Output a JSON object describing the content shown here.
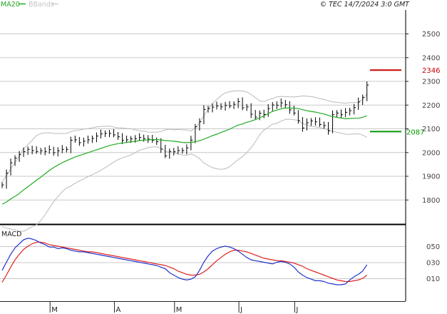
{
  "header": {
    "legend_ma": "MA20",
    "legend_bb": "BBands",
    "copyright": "© TEC 14/7/2024 3:0 GMT"
  },
  "macd_panel": {
    "label": "MACD"
  },
  "colors": {
    "background": "#ffffff",
    "grid": "#c8c8c8",
    "price_bars": "#000000",
    "ma20": "#22aa22",
    "bbands": "#bbbbbb",
    "macd_line": "#2233cc",
    "signal_line": "#dd2222",
    "marker_upper": "#cc0000",
    "marker_lower": "#009900"
  },
  "chart_data": [
    {
      "type": "line",
      "subtype": "ohlc-bars with MA20 and Bollinger Bands",
      "title": "",
      "xlabel": "",
      "ylabel": "",
      "ylim": [
        1700,
        2600
      ],
      "y_ticks": [
        1800,
        1900,
        2000,
        2100,
        2200,
        2300,
        2400,
        2500
      ],
      "y_tick_labels": [
        "1800",
        "1900",
        "2000",
        "2100",
        "2200",
        "2300",
        "2400",
        "2500"
      ],
      "x_month_labels": [
        "M",
        "A",
        "M",
        "J",
        "J"
      ],
      "month_start_index": [
        11,
        26,
        40,
        55,
        68
      ],
      "grid": true,
      "markers": [
        {
          "label": "2346",
          "value": 2346,
          "color": "#cc0000"
        },
        {
          "label": "2087",
          "value": 2087,
          "color": "#009900"
        }
      ],
      "close": [
        1862,
        1912,
        1955,
        1975,
        1990,
        2002,
        2012,
        2007,
        2003,
        2006,
        2003,
        2011,
        1998,
        2006,
        2012,
        2012,
        2050,
        2052,
        2040,
        2046,
        2052,
        2058,
        2068,
        2077,
        2079,
        2079,
        2073,
        2065,
        2050,
        2052,
        2056,
        2057,
        2062,
        2057,
        2055,
        2050,
        2044,
        2013,
        1985,
        2003,
        2002,
        2007,
        2007,
        2018,
        2051,
        2107,
        2128,
        2180,
        2184,
        2190,
        2195,
        2191,
        2197,
        2195,
        2202,
        2213,
        2187,
        2191,
        2160,
        2148,
        2164,
        2159,
        2184,
        2199,
        2198,
        2208,
        2200,
        2178,
        2165,
        2133,
        2102,
        2124,
        2132,
        2128,
        2117,
        2112,
        2090,
        2158,
        2165,
        2158,
        2168,
        2175,
        2188,
        2212,
        2231,
        2283
      ],
      "series": [
        {
          "name": "MA20",
          "values": [
            1781,
            1790,
            1803,
            1814,
            1826,
            1841,
            1854,
            1868,
            1882,
            1895,
            1909,
            1923,
            1935,
            1946,
            1956,
            1964,
            1972,
            1980,
            1986,
            1992,
            1998,
            2004,
            2010,
            2016,
            2022,
            2028,
            2032,
            2036,
            2039,
            2041,
            2044,
            2046,
            2049,
            2051,
            2052,
            2053,
            2053,
            2052,
            2049,
            2048,
            2046,
            2044,
            2041,
            2040,
            2041,
            2044,
            2048,
            2055,
            2062,
            2070,
            2076,
            2083,
            2090,
            2097,
            2106,
            2114,
            2119,
            2126,
            2131,
            2137,
            2145,
            2153,
            2163,
            2172,
            2177,
            2183,
            2186,
            2186,
            2185,
            2184,
            2179,
            2175,
            2172,
            2169,
            2165,
            2161,
            2155,
            2150,
            2147,
            2144,
            2141,
            2142,
            2143,
            2143,
            2147,
            2154
          ]
        },
        {
          "name": "BBands upper",
          "values": [
            1875,
            1900,
            1930,
            1956,
            1985,
            2015,
            2032,
            2050,
            2070,
            2078,
            2082,
            2082,
            2079,
            2079,
            2078,
            2079,
            2087,
            2091,
            2093,
            2097,
            2099,
            2103,
            2106,
            2108,
            2109,
            2110,
            2106,
            2103,
            2102,
            2100,
            2099,
            2094,
            2090,
            2089,
            2085,
            2084,
            2084,
            2087,
            2094,
            2097,
            2094,
            2096,
            2094,
            2093,
            2089,
            2103,
            2123,
            2155,
            2180,
            2205,
            2222,
            2238,
            2250,
            2255,
            2258,
            2259,
            2257,
            2254,
            2243,
            2230,
            2217,
            2213,
            2221,
            2226,
            2233,
            2235,
            2234,
            2233,
            2233,
            2234,
            2237,
            2236,
            2234,
            2231,
            2226,
            2222,
            2217,
            2212,
            2210,
            2208,
            2206,
            2209,
            2209,
            2209,
            2222,
            2245
          ]
        },
        {
          "name": "BBands lower",
          "values": [
            1687,
            1680,
            1676,
            1672,
            1667,
            1667,
            1676,
            1686,
            1694,
            1712,
            1736,
            1764,
            1791,
            1813,
            1834,
            1849,
            1857,
            1869,
            1879,
            1887,
            1897,
            1905,
            1914,
            1924,
            1935,
            1946,
            1958,
            1969,
            1976,
            1982,
            1989,
            1998,
            2008,
            2013,
            2019,
            2022,
            2022,
            2017,
            2004,
            1999,
            1998,
            1992,
            1988,
            1987,
            1993,
            1985,
            1973,
            1955,
            1944,
            1935,
            1930,
            1928,
            1930,
            1939,
            1954,
            1969,
            1981,
            1998,
            2019,
            2044,
            2073,
            2093,
            2105,
            2118,
            2121,
            2131,
            2138,
            2139,
            2137,
            2134,
            2121,
            2114,
            2110,
            2107,
            2104,
            2100,
            2093,
            2088,
            2084,
            2080,
            2076,
            2075,
            2077,
            2077,
            2072,
            2063
          ]
        }
      ]
    },
    {
      "type": "line",
      "title": "MACD",
      "ylim": [
        -25,
        65
      ],
      "y_ticks": [
        10,
        30,
        50
      ],
      "y_tick_labels": [
        "010",
        "030",
        "050"
      ],
      "grid": true,
      "series": [
        {
          "name": "MACD",
          "values": [
            20,
            30,
            40,
            48,
            53,
            58,
            60,
            59,
            57,
            54,
            52,
            49,
            49,
            47,
            48,
            47,
            45,
            44,
            43,
            43,
            42,
            41,
            40,
            39,
            38,
            37,
            36,
            35,
            34,
            33,
            32,
            31,
            30,
            29,
            28,
            27,
            26,
            24,
            22,
            17,
            14,
            11,
            9,
            8,
            9,
            12,
            20,
            30,
            38,
            44,
            47,
            49,
            50,
            49,
            47,
            44,
            40,
            36,
            33,
            32,
            31,
            30,
            29,
            28,
            30,
            31,
            30,
            28,
            24,
            18,
            14,
            11,
            9,
            7,
            7,
            6,
            4,
            3,
            2,
            2,
            3,
            8,
            12,
            15,
            19,
            27
          ]
        },
        {
          "name": "Signal",
          "values": [
            5,
            14,
            24,
            33,
            40,
            46,
            50,
            53,
            55,
            55,
            54,
            52,
            51,
            50,
            49,
            48,
            47,
            46,
            45,
            44,
            43,
            43,
            42,
            41,
            40,
            39,
            38,
            37,
            36,
            35,
            34,
            33,
            32,
            31,
            30,
            29,
            28,
            27,
            26,
            24,
            22,
            19,
            17,
            15,
            14,
            14,
            15,
            18,
            22,
            27,
            32,
            36,
            40,
            43,
            45,
            45,
            44,
            43,
            41,
            39,
            37,
            35,
            34,
            33,
            32,
            32,
            31,
            30,
            29,
            27,
            25,
            22,
            20,
            18,
            16,
            14,
            12,
            10,
            8,
            7,
            6,
            6,
            7,
            8,
            10,
            14
          ]
        }
      ]
    }
  ]
}
